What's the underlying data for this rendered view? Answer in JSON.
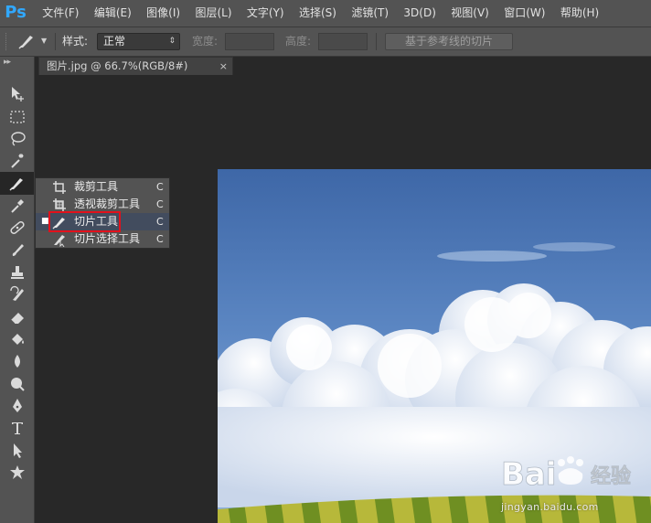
{
  "app": {
    "logo_text": "Ps",
    "accent_color": "#31a8ff"
  },
  "menu": [
    {
      "label": "文件(F)"
    },
    {
      "label": "编辑(E)"
    },
    {
      "label": "图像(I)"
    },
    {
      "label": "图层(L)"
    },
    {
      "label": "文字(Y)"
    },
    {
      "label": "选择(S)"
    },
    {
      "label": "滤镜(T)"
    },
    {
      "label": "3D(D)"
    },
    {
      "label": "视图(V)"
    },
    {
      "label": "窗口(W)"
    },
    {
      "label": "帮助(H)"
    }
  ],
  "options_bar": {
    "tool_icon": "slice-tool-icon",
    "style_label": "样式:",
    "style_value": "正常",
    "width_label": "宽度:",
    "height_label": "高度:",
    "slice_from_guides_button": "基于参考线的切片"
  },
  "document_tab": {
    "title": "图片.jpg @ 66.7%(RGB/8#)",
    "close_symbol": "×"
  },
  "tools": [
    {
      "name": "move-tool-icon"
    },
    {
      "name": "marquee-tool-icon"
    },
    {
      "name": "lasso-tool-icon"
    },
    {
      "name": "magic-wand-tool-icon"
    },
    {
      "name": "slice-tool-icon",
      "active": true
    },
    {
      "name": "eyedropper-tool-icon"
    },
    {
      "name": "healing-brush-tool-icon"
    },
    {
      "name": "brush-tool-icon"
    },
    {
      "name": "clone-stamp-tool-icon"
    },
    {
      "name": "history-brush-tool-icon"
    },
    {
      "name": "eraser-tool-icon"
    },
    {
      "name": "paint-bucket-tool-icon"
    },
    {
      "name": "blur-tool-icon"
    },
    {
      "name": "dodge-tool-icon"
    },
    {
      "name": "pen-tool-icon"
    },
    {
      "name": "type-tool-icon"
    },
    {
      "name": "path-selection-tool-icon"
    },
    {
      "name": "custom-shape-tool-icon"
    }
  ],
  "flyout_menu": {
    "items": [
      {
        "label": "裁剪工具",
        "shortcut": "C",
        "icon": "crop-tool-icon",
        "selected": false
      },
      {
        "label": "透视裁剪工具",
        "shortcut": "C",
        "icon": "perspective-crop-tool-icon",
        "selected": false
      },
      {
        "label": "切片工具",
        "shortcut": "C",
        "icon": "slice-tool-icon",
        "selected": true,
        "highlight_color": "#e2111b"
      },
      {
        "label": "切片选择工具",
        "shortcut": "C",
        "icon": "slice-select-tool-icon",
        "selected": false
      }
    ],
    "bullet": "■"
  },
  "canvas": {
    "image_subject": "sky-clouds-field-photo",
    "sky_color": "#4d76b4",
    "cloud_color": "#f2f5fa",
    "field_color": "#9aac2c"
  },
  "watermark": {
    "logo_text": "Bai",
    "logo_suffix": "经验",
    "url": "jingyan.baidu.com"
  }
}
